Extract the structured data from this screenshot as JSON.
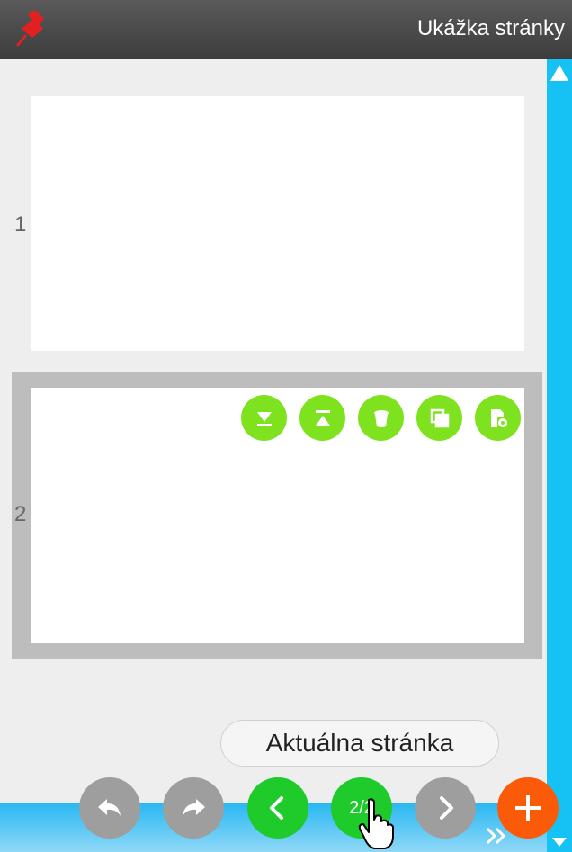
{
  "header": {
    "title": "Ukážka stránky",
    "pin_icon": "pin-icon"
  },
  "pages": [
    {
      "number": "1",
      "selected": false
    },
    {
      "number": "2",
      "selected": true
    }
  ],
  "page_actions": [
    "move-down-icon",
    "move-up-icon",
    "delete-icon",
    "duplicate-icon",
    "page-settings-icon"
  ],
  "current_page_label": "Aktuálna stránka",
  "navigation": {
    "page_indicator": "2/2"
  },
  "colors": {
    "header": "#444444",
    "scrollbar": "#16c1f3",
    "action_green": "#7ee31e",
    "nav_green": "#1ecb2a",
    "nav_grey": "#9e9e9e",
    "add_orange": "#fb5a08",
    "selection_frame": "#bdbdbd"
  }
}
